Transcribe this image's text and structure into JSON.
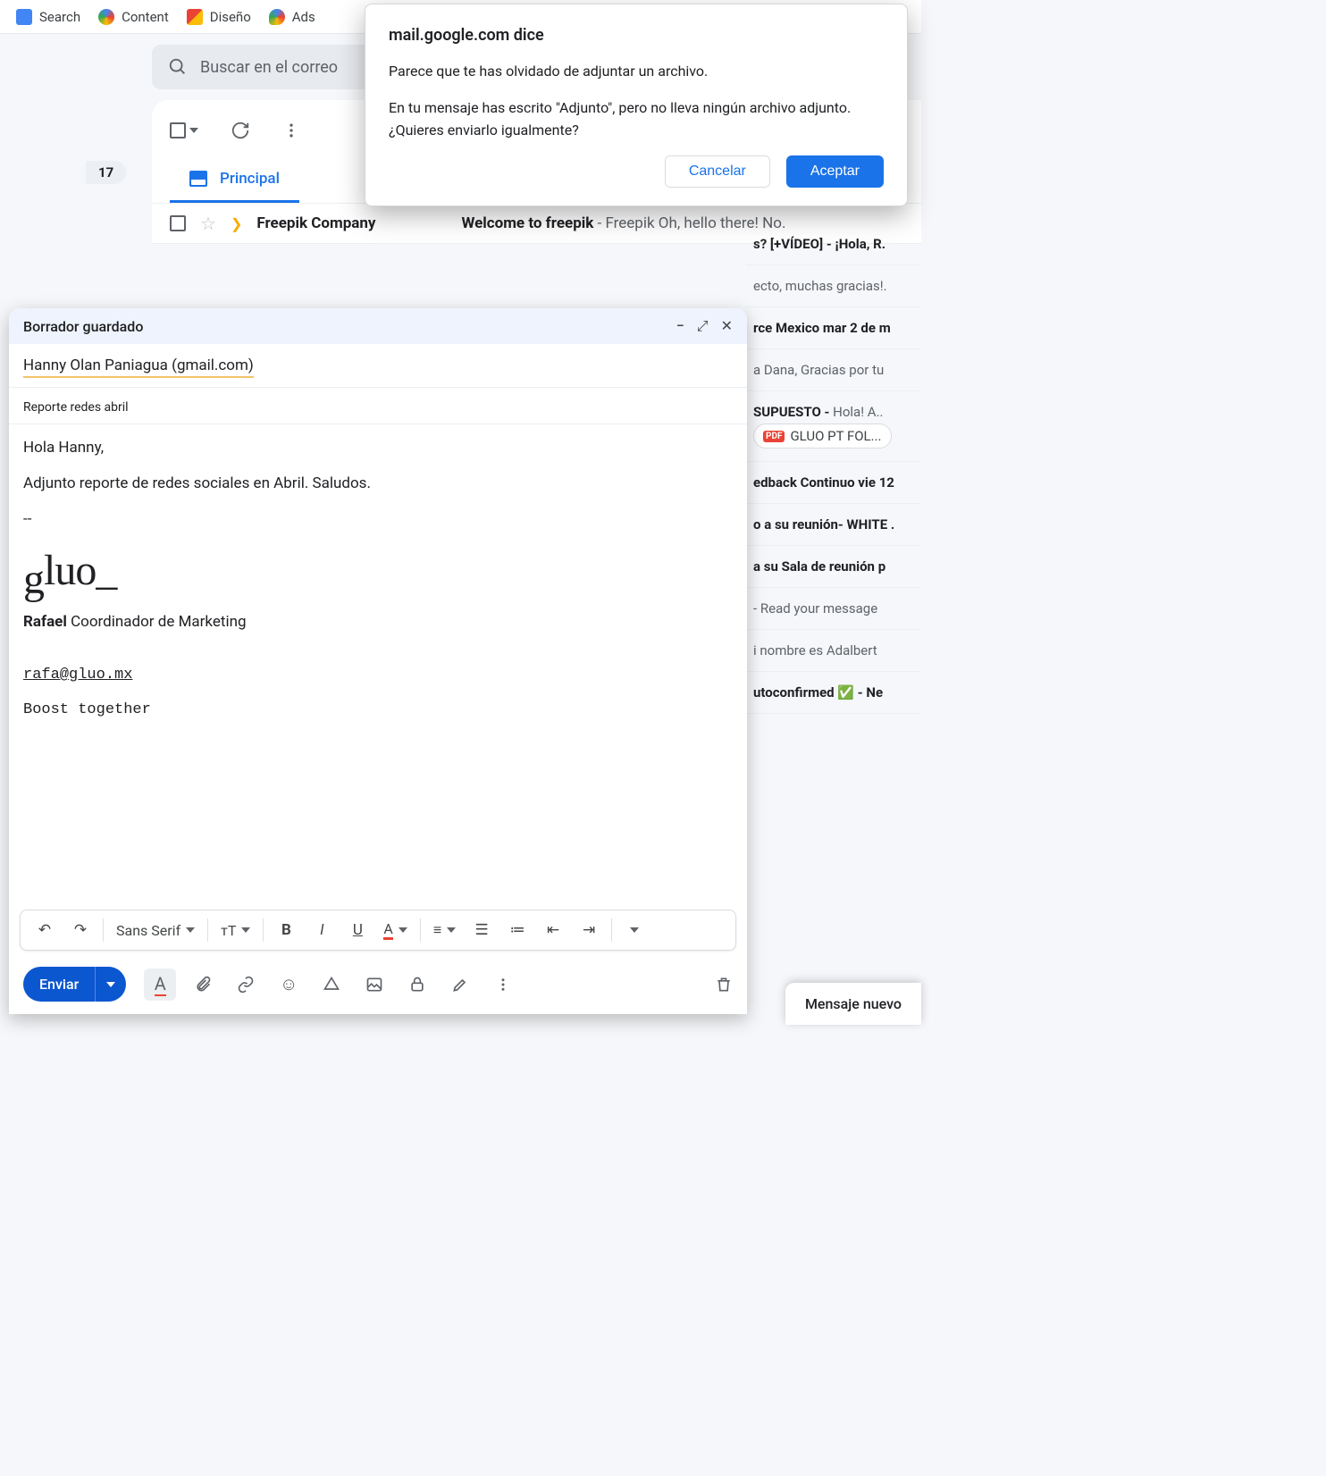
{
  "bookmarks": [
    {
      "label": "Search"
    },
    {
      "label": "Content"
    },
    {
      "label": "Diseño"
    },
    {
      "label": "Ads"
    }
  ],
  "search": {
    "placeholder": "Buscar en el correo"
  },
  "sidebar": {
    "unread_count": "17"
  },
  "tabs": {
    "principal": "Principal"
  },
  "email_row": {
    "sender": "Freepik Company",
    "subject": "Welcome to freepik",
    "snippet": " - Freepik Oh, hello there! No."
  },
  "bg_rows": {
    "r1": "s? [+VÍDEO] - ¡Hola, R.",
    "r2": "ecto, muchas gracias!.",
    "r3": "rce Mexico mar 2 de m",
    "r4": "a Dana, Gracias por tu",
    "r5a": "SUPUESTO -",
    "r5b": " Hola! A..",
    "r5_chip": "GLUO PT FOL...",
    "r6": "edback Continuo vie 12",
    "r7": "o a su reunión- WHITE .",
    "r8": "a su Sala de reunión p",
    "r9": " - Read your message",
    "r10": "i nombre es Adalbert",
    "r11": "utoconfirmed ✅ - Ne"
  },
  "compose": {
    "header_title": "Borrador guardado",
    "recipient": "Hanny Olan Paniagua (gmail.com)",
    "subject": "Reporte redes abril",
    "body_greeting": "Hola Hanny,",
    "body_text": "Adjunto reporte de redes sociales en Abril. Saludos.",
    "sig_sep": "--",
    "sig_logo": "gluo_",
    "sig_name": "Rafael",
    "sig_title": " Coordinador de Marketing",
    "sig_email": "rafa@gluo.mx",
    "sig_slogan": "Boost together",
    "font_label": "Sans Serif",
    "size_label": "тT",
    "send_label": "Enviar"
  },
  "dialog": {
    "title": "mail.google.com dice",
    "line1": "Parece que te has olvidado de adjuntar un archivo.",
    "line2": "En tu mensaje has escrito \"Adjunto\", pero no lleva ningún archivo adjunto. ¿Quieres enviarlo igualmente?",
    "cancel": "Cancelar",
    "accept": "Aceptar"
  },
  "new_msg": "Mensaje nuevo",
  "pdf_label": "PDF"
}
